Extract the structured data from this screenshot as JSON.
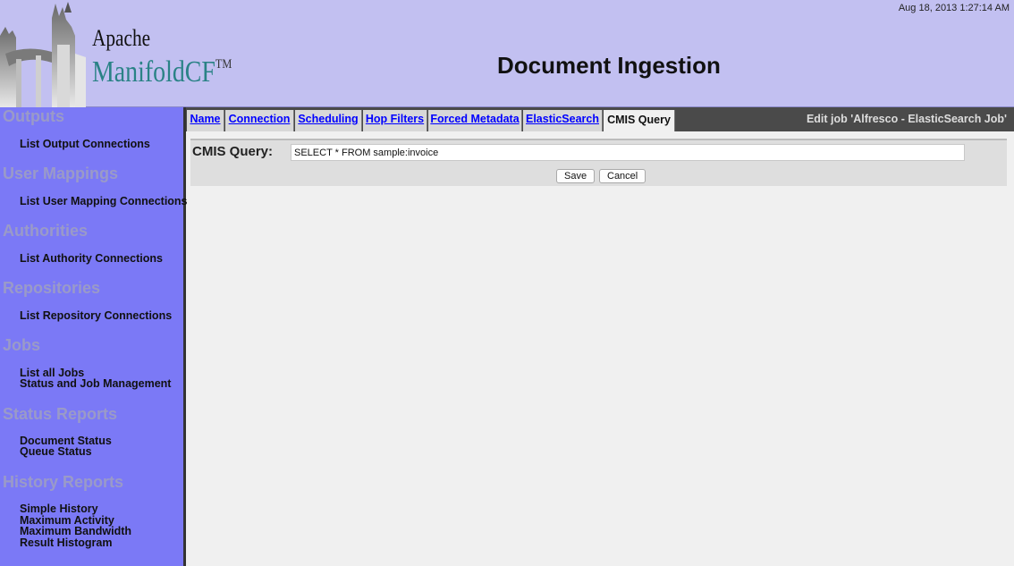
{
  "header": {
    "timestamp": "Aug 18, 2013 1:27:14 AM",
    "brand_line1": "Apache",
    "brand_line2": "ManifoldCF",
    "trademark": "TM",
    "page_title": "Document Ingestion"
  },
  "sidebar": {
    "sections": [
      {
        "title": "Outputs",
        "links": [
          "List Output Connections"
        ]
      },
      {
        "title": "User Mappings",
        "links": [
          "List User Mapping Connections"
        ]
      },
      {
        "title": "Authorities",
        "links": [
          "List Authority Connections"
        ]
      },
      {
        "title": "Repositories",
        "links": [
          "List Repository Connections"
        ]
      },
      {
        "title": "Jobs",
        "links": [
          "List all Jobs",
          "Status and Job Management"
        ]
      },
      {
        "title": "Status Reports",
        "links": [
          "Document Status",
          "Queue Status"
        ]
      },
      {
        "title": "History Reports",
        "links": [
          "Simple History",
          "Maximum Activity",
          "Maximum Bandwidth",
          "Result Histogram"
        ]
      }
    ]
  },
  "tabs": [
    "Name",
    "Connection",
    "Scheduling",
    "Hop Filters",
    "Forced Metadata",
    "ElasticSearch",
    "CMIS Query"
  ],
  "active_tab": "CMIS Query",
  "edit_job_label": "Edit job 'Alfresco - ElasticSearch Job'",
  "form": {
    "cmis_label": "CMIS Query:",
    "cmis_value": "SELECT * FROM sample:invoice",
    "save_label": "Save",
    "cancel_label": "Cancel"
  },
  "colors": {
    "header_bg": "#c2c0f1",
    "sidebar_bg": "#7b79f6",
    "brand_teal": "#2a8286",
    "link_blue": "#0000ff"
  }
}
